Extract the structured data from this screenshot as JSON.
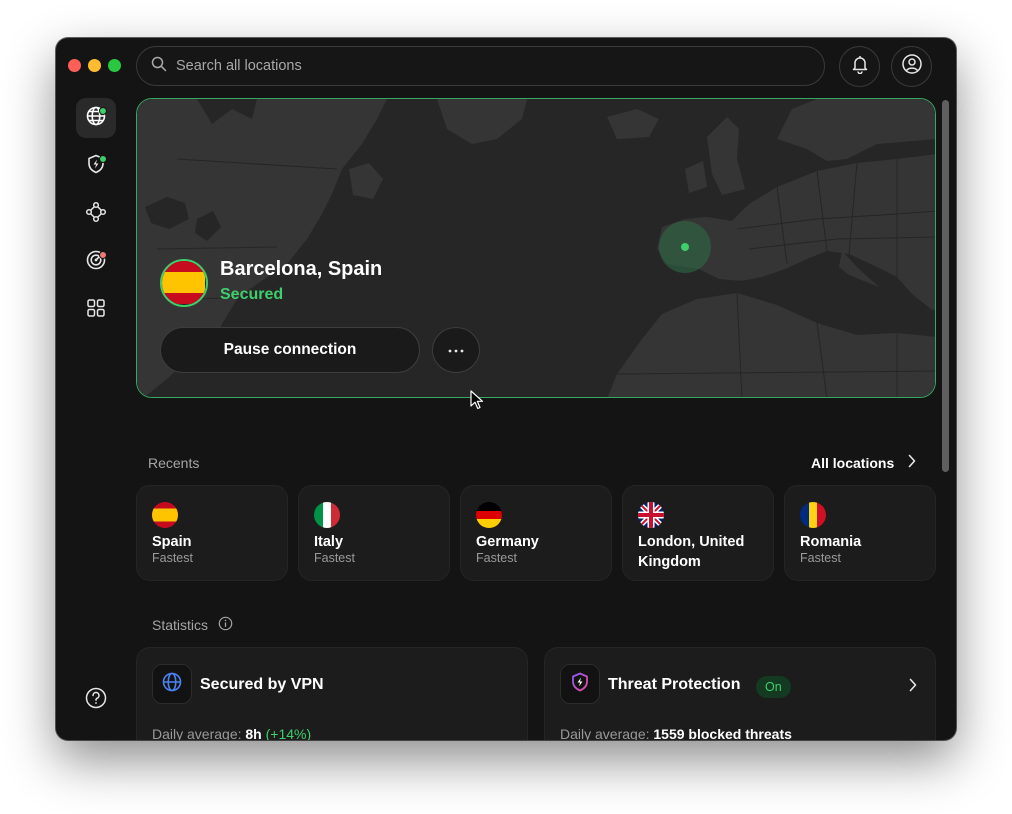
{
  "window": {
    "traffic_lights": [
      "close",
      "minimize",
      "zoom"
    ]
  },
  "search": {
    "placeholder": "Search all locations"
  },
  "header": {
    "notifications_icon": "bell-icon",
    "account_icon": "user-circle-icon"
  },
  "sidebar": {
    "items": [
      {
        "id": "vpn",
        "icon": "globe-icon",
        "active": true,
        "badge": "green"
      },
      {
        "id": "threat-protection",
        "icon": "shield-bolt-icon",
        "active": false,
        "badge": "green"
      },
      {
        "id": "meshnet",
        "icon": "mesh-network-icon",
        "active": false,
        "badge": null
      },
      {
        "id": "dark-web-monitor",
        "icon": "radar-icon",
        "active": false,
        "badge": "red"
      },
      {
        "id": "apps",
        "icon": "apps-grid-icon",
        "active": false,
        "badge": null
      }
    ],
    "help_icon": "help-icon"
  },
  "connection": {
    "location": "Barcelona, Spain",
    "status": "Secured",
    "pause_label": "Pause connection",
    "more_label": "···"
  },
  "recents": {
    "title": "Recents",
    "all_locations_label": "All locations",
    "items": [
      {
        "name": "Spain",
        "sub": "Fastest",
        "flag": "es"
      },
      {
        "name": "Italy",
        "sub": "Fastest",
        "flag": "it"
      },
      {
        "name": "Germany",
        "sub": "Fastest",
        "flag": "de"
      },
      {
        "name": "London, United Kingdom",
        "sub": "",
        "flag": "gb"
      },
      {
        "name": "Romania",
        "sub": "Fastest",
        "flag": "ro"
      }
    ]
  },
  "statistics": {
    "title": "Statistics",
    "cards": [
      {
        "title": "Secured by VPN",
        "prefix": "Daily average:",
        "value": "8h",
        "delta": "(+14%)",
        "icon": "globe-icon"
      },
      {
        "title": "Threat Protection",
        "badge": "On",
        "prefix": "Daily average:",
        "value": "1559 blocked threats",
        "icon": "shield-bolt-icon"
      }
    ]
  },
  "colors": {
    "accent_green": "#3ecf6c",
    "background": "#141414",
    "card": "#1c1c1c",
    "map_land": "#333333",
    "map_sea": "#262626"
  }
}
